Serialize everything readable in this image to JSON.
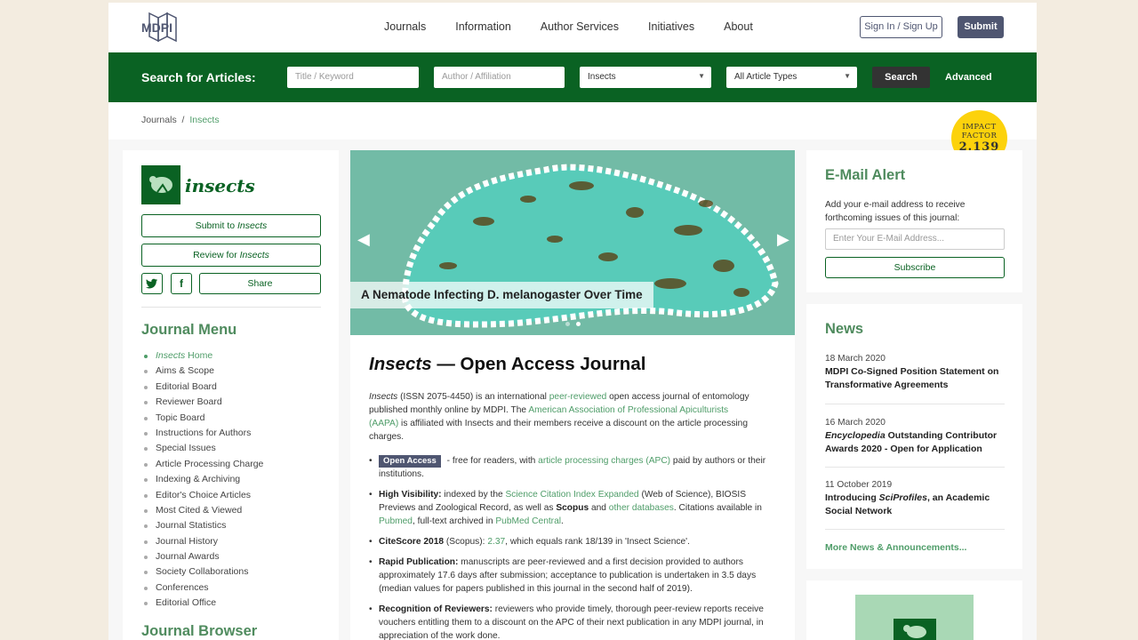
{
  "header": {
    "logo_text": "MDPI",
    "nav": [
      "Journals",
      "Information",
      "Author Services",
      "Initiatives",
      "About"
    ],
    "sign_in": "Sign In / Sign Up",
    "submit": "Submit"
  },
  "search": {
    "label": "Search for Articles:",
    "title_placeholder": "Title / Keyword",
    "author_placeholder": "Author / Affiliation",
    "journal_selected": "Insects",
    "type_selected": "All Article Types",
    "button": "Search",
    "advanced": "Advanced"
  },
  "breadcrumb": {
    "root": "Journals",
    "sep": "/",
    "current": "Insects"
  },
  "impact": {
    "label1": "IMPACT",
    "label2": "FACTOR",
    "value": "2.139"
  },
  "left": {
    "journal_name": "insects",
    "submit_to": "Submit to",
    "review_for": "Review for",
    "journal_italic": "Insects",
    "share": "Share",
    "menu_title": "Journal Menu",
    "menu_items": [
      "Insects Home",
      "Aims & Scope",
      "Editorial Board",
      "Reviewer Board",
      "Topic Board",
      "Instructions for Authors",
      "Special Issues",
      "Article Processing Charge",
      "Indexing & Archiving",
      "Editor's Choice Articles",
      "Most Cited & Viewed",
      "Journal Statistics",
      "Journal History",
      "Journal Awards",
      "Society Collaborations",
      "Conferences",
      "Editorial Office"
    ],
    "browser_title": "Journal Browser"
  },
  "banner": {
    "caption": "A Nematode Infecting D. melanogaster Over Time",
    "slides": 2,
    "active_slide": 2
  },
  "main": {
    "title_journal": "Insects",
    "title_rest": " — Open Access Journal",
    "intro": {
      "journal": "Insects",
      "p1": " (ISSN 2075-4450) is an international ",
      "l1": "peer-reviewed",
      "p2": " open access journal of entomology published monthly online by MDPI. The ",
      "l2": "American Association of Professional Apiculturists (AAPA)",
      "p3": " is affiliated with Insects and their members receive a discount on the article processing charges."
    },
    "b1": {
      "badge": "Open Access",
      "t1": " - free for readers, with ",
      "l1": "article processing charges (APC)",
      "t2": " paid by authors or their institutions."
    },
    "b2": {
      "head": "High Visibility:",
      "t1": " indexed by the ",
      "l1": "Science Citation Index Expanded",
      "t2": " (Web of Science), BIOSIS Previews and Zoological Record, as well as ",
      "l2": "Scopus",
      "t3": " and ",
      "l3": "other databases",
      "t4": ". Citations available in ",
      "l4": "Pubmed",
      "t5": ", full-text archived in ",
      "l5": "PubMed Central",
      "t6": "."
    },
    "b3": {
      "head": "CiteScore 2018",
      "t1": " (Scopus): ",
      "l1": "2.37",
      "t2": ", which equals rank 18/139 in 'Insect Science'."
    },
    "b4": {
      "head": "Rapid Publication:",
      "t1": " manuscripts are peer-reviewed and a first decision provided to authors approximately 17.6 days after submission; acceptance to publication is undertaken in 3.5 days (median values for papers published in this journal in the second half of 2019)."
    },
    "b5": {
      "head": "Recognition of Reviewers:",
      "t1": " reviewers who provide timely, thorough peer-review reports receive vouchers entitling them to a discount on the APC of their next publication in any MDPI journal, in appreciation of the work done."
    }
  },
  "alert": {
    "title": "E-Mail Alert",
    "text": "Add your e-mail address to receive forthcoming issues of this journal:",
    "placeholder": "Enter Your E-Mail Address...",
    "button": "Subscribe"
  },
  "news": {
    "title": "News",
    "items": [
      {
        "date": "18 March 2020",
        "title": "MDPI Co-Signed Position Statement on Transformative Agreements"
      },
      {
        "date": "16 March 2020",
        "title_italic": "Encyclopedia",
        "title_rest": " Outstanding Contributor Awards 2020 - Open for Application"
      },
      {
        "date": "11 October 2019",
        "title_pre": "Introducing ",
        "title_italic": "SciProfiles",
        "title_rest": ", an Academic Social Network"
      }
    ],
    "more": "More News & Announcements..."
  },
  "colors": {
    "green": "#0a6223",
    "slate": "#4f5671",
    "link": "#4f9d69",
    "impact": "#fcd20c"
  }
}
